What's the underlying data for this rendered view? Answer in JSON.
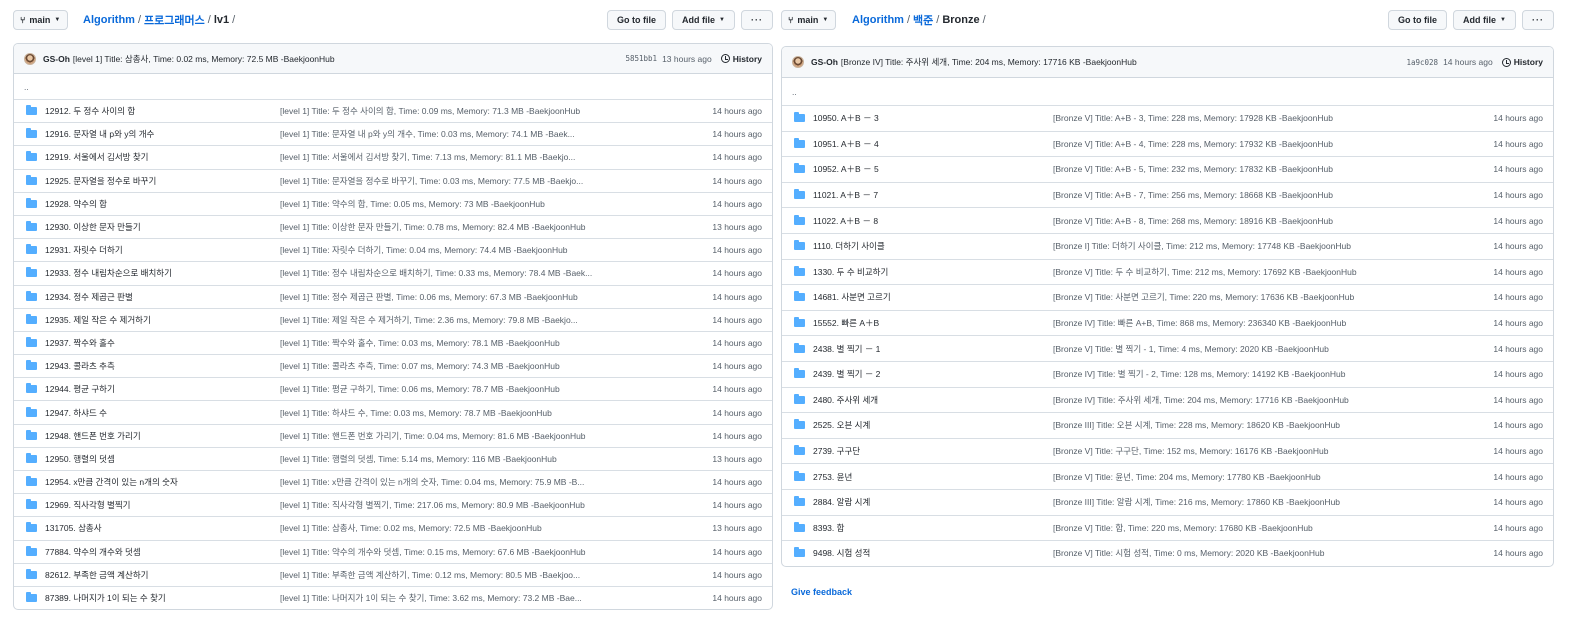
{
  "left": {
    "branch": "main",
    "breadcrumb": {
      "repo": "Algorithm",
      "folder": "프로그래머스",
      "current": "lv1"
    },
    "goto_file": "Go to file",
    "add_file": "Add file",
    "more": "···",
    "commit": {
      "author": "GS-Oh",
      "message": "[level 1] Title: 삼총사, Time: 0.02 ms, Memory: 72.5 MB -BaekjoonHub",
      "sha": "5851bb1",
      "age": "13 hours ago",
      "history": "History"
    },
    "up": "..",
    "rows": [
      {
        "name": "12912. 두 정수 사이의 합",
        "msg": "[level 1] Title: 두 정수 사이의 합, Time: 0.09 ms, Memory: 71.3 MB -BaekjoonHub",
        "age": "14 hours ago"
      },
      {
        "name": "12916. 문자열 내 p와 y의 개수",
        "msg": "[level 1] Title: 문자열 내 p와 y의 개수, Time: 0.03 ms, Memory: 74.1 MB -Baek...",
        "age": "14 hours ago"
      },
      {
        "name": "12919. 서울에서 김서방 찾기",
        "msg": "[level 1] Title: 서울에서 김서방 찾기, Time: 7.13 ms, Memory: 81.1 MB -Baekjo...",
        "age": "14 hours ago"
      },
      {
        "name": "12925. 문자열을 정수로 바꾸기",
        "msg": "[level 1] Title: 문자열을 정수로 바꾸기, Time: 0.03 ms, Memory: 77.5 MB -Baekjo...",
        "age": "14 hours ago"
      },
      {
        "name": "12928. 약수의 합",
        "msg": "[level 1] Title: 약수의 합, Time: 0.05 ms, Memory: 73 MB -BaekjoonHub",
        "age": "14 hours ago"
      },
      {
        "name": "12930. 이상한 문자 만들기",
        "msg": "[level 1] Title: 이상한 문자 만들기, Time: 0.78 ms, Memory: 82.4 MB -BaekjoonHub",
        "age": "13 hours ago"
      },
      {
        "name": "12931. 자릿수 더하기",
        "msg": "[level 1] Title: 자릿수 더하기, Time: 0.04 ms, Memory: 74.4 MB -BaekjoonHub",
        "age": "14 hours ago"
      },
      {
        "name": "12933. 정수 내림차순으로 배치하기",
        "msg": "[level 1] Title: 정수 내림차순으로 배치하기, Time: 0.33 ms, Memory: 78.4 MB -Baek...",
        "age": "14 hours ago"
      },
      {
        "name": "12934. 정수 제곱근 판별",
        "msg": "[level 1] Title: 정수 제곱근 판별, Time: 0.06 ms, Memory: 67.3 MB -BaekjoonHub",
        "age": "14 hours ago"
      },
      {
        "name": "12935. 제일 작은 수 제거하기",
        "msg": "[level 1] Title: 제일 작은 수 제거하기, Time: 2.36 ms, Memory: 79.8 MB -Baekjo...",
        "age": "14 hours ago"
      },
      {
        "name": "12937. 짝수와 홀수",
        "msg": "[level 1] Title: 짝수와 홀수, Time: 0.03 ms, Memory: 78.1 MB -BaekjoonHub",
        "age": "14 hours ago"
      },
      {
        "name": "12943. 콜라츠 추측",
        "msg": "[level 1] Title: 콜라츠 추측, Time: 0.07 ms, Memory: 74.3 MB -BaekjoonHub",
        "age": "14 hours ago"
      },
      {
        "name": "12944. 평균 구하기",
        "msg": "[level 1] Title: 평균 구하기, Time: 0.06 ms, Memory: 78.7 MB -BaekjoonHub",
        "age": "14 hours ago"
      },
      {
        "name": "12947. 하샤드 수",
        "msg": "[level 1] Title: 하샤드 수, Time: 0.03 ms, Memory: 78.7 MB -BaekjoonHub",
        "age": "14 hours ago"
      },
      {
        "name": "12948. 핸드폰 번호 가리기",
        "msg": "[level 1] Title: 핸드폰 번호 가리기, Time: 0.04 ms, Memory: 81.6 MB -BaekjoonHub",
        "age": "14 hours ago"
      },
      {
        "name": "12950. 행렬의 덧셈",
        "msg": "[level 1] Title: 행렬의 덧셈, Time: 5.14 ms, Memory: 116 MB -BaekjoonHub",
        "age": "13 hours ago"
      },
      {
        "name": "12954. x만큼 간격이 있는 n개의 숫자",
        "msg": "[level 1] Title: x만큼 간격이 있는 n개의 숫자, Time: 0.04 ms, Memory: 75.9 MB -B...",
        "age": "14 hours ago"
      },
      {
        "name": "12969. 직사각형 별찍기",
        "msg": "[level 1] Title: 직사각형 별찍기, Time: 217.06 ms, Memory: 80.9 MB -BaekjoonHub",
        "age": "14 hours ago"
      },
      {
        "name": "131705. 삼총사",
        "msg": "[level 1] Title: 삼총사, Time: 0.02 ms, Memory: 72.5 MB -BaekjoonHub",
        "age": "13 hours ago"
      },
      {
        "name": "77884. 약수의 개수와 덧셈",
        "msg": "[level 1] Title: 약수의 개수와 덧셈, Time: 0.15 ms, Memory: 67.6 MB -BaekjoonHub",
        "age": "14 hours ago"
      },
      {
        "name": "82612. 부족한 금액 계산하기",
        "msg": "[level 1] Title: 부족한 금액 계산하기, Time: 0.12 ms, Memory: 80.5 MB -Baekjoo...",
        "age": "14 hours ago"
      },
      {
        "name": "87389. 나머지가 1이 되는 수 찾기",
        "msg": "[level 1] Title: 나머지가 1이 되는 수 찾기, Time: 3.62 ms, Memory: 73.2 MB -Bae...",
        "age": "14 hours ago"
      }
    ]
  },
  "right": {
    "branch": "main",
    "breadcrumb": {
      "repo": "Algorithm",
      "folder": "백준",
      "current": "Bronze"
    },
    "goto_file": "Go to file",
    "add_file": "Add file",
    "more": "···",
    "commit": {
      "author": "GS-Oh",
      "message": "[Bronze IV] Title: 주사위 세개, Time: 204 ms, Memory: 17716 KB -BaekjoonHub",
      "sha": "1a9c028",
      "age": "14 hours ago",
      "history": "History"
    },
    "up": "..",
    "rows": [
      {
        "name": "10950. A＋B － 3",
        "msg": "[Bronze V] Title: A+B - 3, Time: 228 ms, Memory: 17928 KB -BaekjoonHub",
        "age": "14 hours ago"
      },
      {
        "name": "10951. A＋B － 4",
        "msg": "[Bronze V] Title: A+B - 4, Time: 228 ms, Memory: 17932 KB -BaekjoonHub",
        "age": "14 hours ago"
      },
      {
        "name": "10952. A＋B － 5",
        "msg": "[Bronze V] Title: A+B - 5, Time: 232 ms, Memory: 17832 KB -BaekjoonHub",
        "age": "14 hours ago"
      },
      {
        "name": "11021. A＋B － 7",
        "msg": "[Bronze V] Title: A+B - 7, Time: 256 ms, Memory: 18668 KB -BaekjoonHub",
        "age": "14 hours ago"
      },
      {
        "name": "11022. A＋B － 8",
        "msg": "[Bronze V] Title: A+B - 8, Time: 268 ms, Memory: 18916 KB -BaekjoonHub",
        "age": "14 hours ago"
      },
      {
        "name": "1110. 더하기 사이클",
        "msg": "[Bronze I] Title: 더하기 사이클, Time: 212 ms, Memory: 17748 KB -BaekjoonHub",
        "age": "14 hours ago"
      },
      {
        "name": "1330. 두 수 비교하기",
        "msg": "[Bronze V] Title: 두 수 비교하기, Time: 212 ms, Memory: 17692 KB -BaekjoonHub",
        "age": "14 hours ago"
      },
      {
        "name": "14681. 사분면 고르기",
        "msg": "[Bronze V] Title: 사분면 고르기, Time: 220 ms, Memory: 17636 KB -BaekjoonHub",
        "age": "14 hours ago"
      },
      {
        "name": "15552. 빠른 A＋B",
        "msg": "[Bronze IV] Title: 빠른 A+B, Time: 868 ms, Memory: 236340 KB -BaekjoonHub",
        "age": "14 hours ago"
      },
      {
        "name": "2438. 별 찍기 － 1",
        "msg": "[Bronze V] Title: 별 찍기 - 1, Time: 4 ms, Memory: 2020 KB -BaekjoonHub",
        "age": "14 hours ago"
      },
      {
        "name": "2439. 별 찍기 － 2",
        "msg": "[Bronze IV] Title: 별 찍기 - 2, Time: 128 ms, Memory: 14192 KB -BaekjoonHub",
        "age": "14 hours ago"
      },
      {
        "name": "2480. 주사위 세개",
        "msg": "[Bronze IV] Title: 주사위 세개, Time: 204 ms, Memory: 17716 KB -BaekjoonHub",
        "age": "14 hours ago"
      },
      {
        "name": "2525. 오븐 시계",
        "msg": "[Bronze III] Title: 오븐 시계, Time: 228 ms, Memory: 18620 KB -BaekjoonHub",
        "age": "14 hours ago"
      },
      {
        "name": "2739. 구구단",
        "msg": "[Bronze V] Title: 구구단, Time: 152 ms, Memory: 16176 KB -BaekjoonHub",
        "age": "14 hours ago"
      },
      {
        "name": "2753. 윤년",
        "msg": "[Bronze V] Title: 윤년, Time: 204 ms, Memory: 17780 KB -BaekjoonHub",
        "age": "14 hours ago"
      },
      {
        "name": "2884. 알람 시계",
        "msg": "[Bronze III] Title: 알람 시계, Time: 216 ms, Memory: 17860 KB -BaekjoonHub",
        "age": "14 hours ago"
      },
      {
        "name": "8393. 합",
        "msg": "[Bronze V] Title: 합, Time: 220 ms, Memory: 17680 KB -BaekjoonHub",
        "age": "14 hours ago"
      },
      {
        "name": "9498. 시험 성적",
        "msg": "[Bronze V] Title: 시험 성적, Time: 0 ms, Memory: 2020 KB -BaekjoonHub",
        "age": "14 hours ago"
      }
    ],
    "feedback": "Give feedback"
  }
}
